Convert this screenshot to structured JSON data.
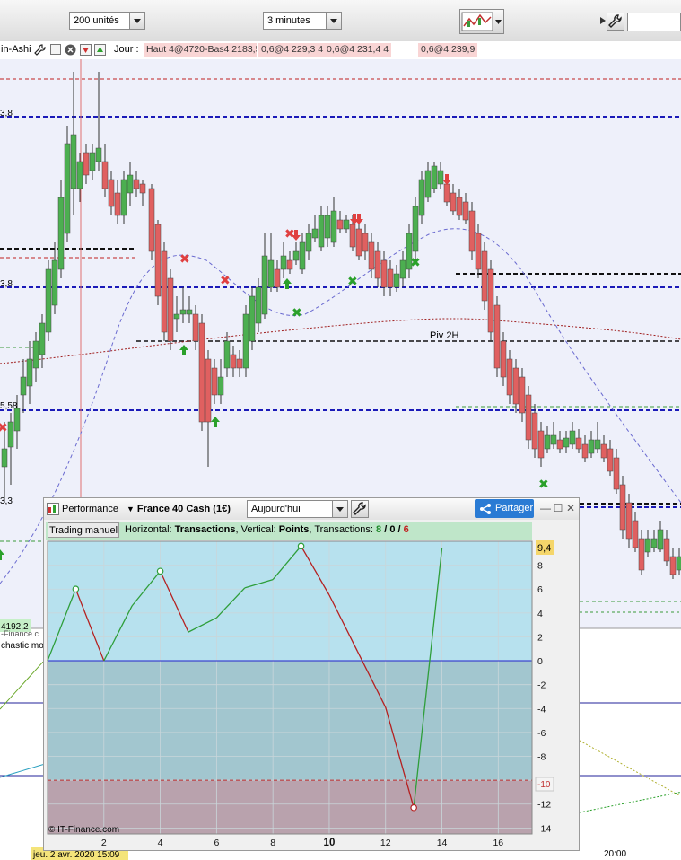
{
  "toolbar": {
    "units_select": "200 unités",
    "interval_select": "3 minutes",
    "chart_type_icon": "candle-chart-icon",
    "settings_icon": "wrench-icon",
    "search_value": ""
  },
  "subbar": {
    "indicator_name": "in-Ashi",
    "day_label": "Jour :",
    "chips": [
      "Haut 4@4720-Bas4 2183,5",
      "0,6@4 229,3 4",
      "0,6@4 231,4 4",
      "0,6@4 239,9"
    ]
  },
  "main_chart": {
    "y_labels": [
      "3,8",
      "3,8",
      "5,58",
      "3,3"
    ],
    "pivot_label": "Piv 2H",
    "stoch_label": "chastic mo",
    "volume_label": "4192,2",
    "copyright_tag": "-Finance.c",
    "time_labels": [
      "jeu. 2 avr. 2020 15:09",
      "20:00"
    ],
    "colors": {
      "up": "#4caf50",
      "down": "#e06060",
      "blue_dashed": "#1a1ab8",
      "black_dashed": "#111111"
    }
  },
  "performance": {
    "title": "Performance",
    "instrument": "France 40 Cash (1€)",
    "period": "Aujourd'hui",
    "share_label": "Partager",
    "trade_button": "Trading manuel",
    "info": {
      "prefix": "Horizontal: ",
      "horizontal": "Transactions",
      "mid": ", Vertical: ",
      "vertical": "Points",
      "suffix": ", Transactions: ",
      "wins": "8",
      "sep1": " / ",
      "neutral": "0",
      "sep2": " / ",
      "losses": "6"
    },
    "copyright": "© IT-Finance.com",
    "current_value_label": "9,4",
    "lower_value_label": "-10",
    "chart_data": {
      "type": "line",
      "x": [
        0,
        1,
        2,
        3,
        4,
        5,
        6,
        7,
        8,
        9,
        10,
        11,
        12,
        13,
        14
      ],
      "y": [
        0,
        6,
        0,
        4.6,
        7.5,
        2.4,
        3.6,
        6.1,
        6.8,
        9.6,
        5.5,
        0.8,
        -3.9,
        -12.3,
        9.4
      ],
      "x_ticks": [
        2,
        4,
        6,
        8,
        10,
        12,
        14,
        16
      ],
      "y_ticks": [
        8,
        6,
        4,
        2,
        0,
        -2,
        -4,
        -6,
        -8,
        -10,
        -12,
        -14
      ],
      "xlim": [
        0,
        17.2
      ],
      "ylim": [
        -14.5,
        10
      ],
      "upper_level": 10,
      "lower_level": -10,
      "grid": true,
      "colors": {
        "gain": "#2e9e3a",
        "loss": "#b52020",
        "zero": "#2222cc",
        "above_zero_band": "#b7e1ee",
        "below_zero_band": "#a2c6cf",
        "loss_zone": "#b9a2ad"
      }
    }
  }
}
